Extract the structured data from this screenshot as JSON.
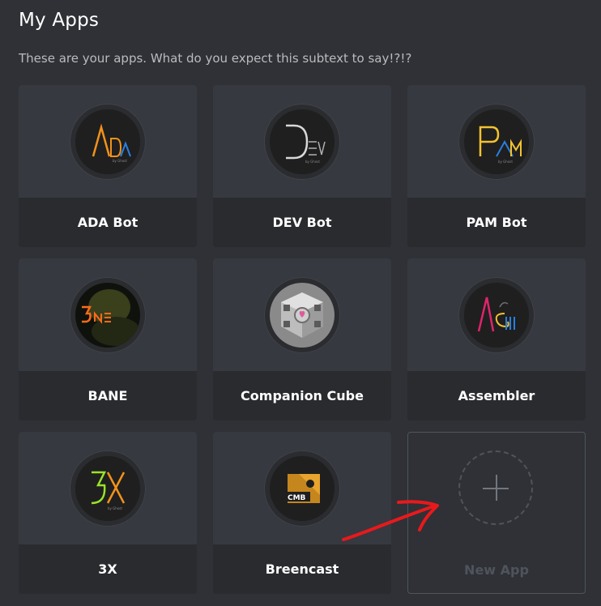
{
  "header": {
    "title": "My Apps",
    "subtitle": "These are your apps. What do you expect this subtext to say!?!?"
  },
  "apps": [
    {
      "name": "ADA Bot",
      "icon": "ada-bot-logo-icon"
    },
    {
      "name": "DEV Bot",
      "icon": "dev-bot-logo-icon"
    },
    {
      "name": "PAM Bot",
      "icon": "pam-bot-logo-icon"
    },
    {
      "name": "BANE",
      "icon": "bane-logo-icon"
    },
    {
      "name": "Companion Cube",
      "icon": "companion-cube-icon"
    },
    {
      "name": "Assembler",
      "icon": "assembler-logo-icon"
    },
    {
      "name": "3X",
      "icon": "3x-logo-icon"
    },
    {
      "name": "Breencast",
      "icon": "breencast-logo-icon"
    }
  ],
  "new_app": {
    "label": "New App",
    "icon": "plus-icon"
  },
  "annotation": {
    "icon": "red-arrow-icon",
    "color": "#e8191c"
  },
  "colors": {
    "background": "#2f3136",
    "card_top": "#36393f",
    "card_bottom": "#292b2f",
    "muted_text": "#b9bbbe",
    "disabled_text": "#4f545c"
  }
}
